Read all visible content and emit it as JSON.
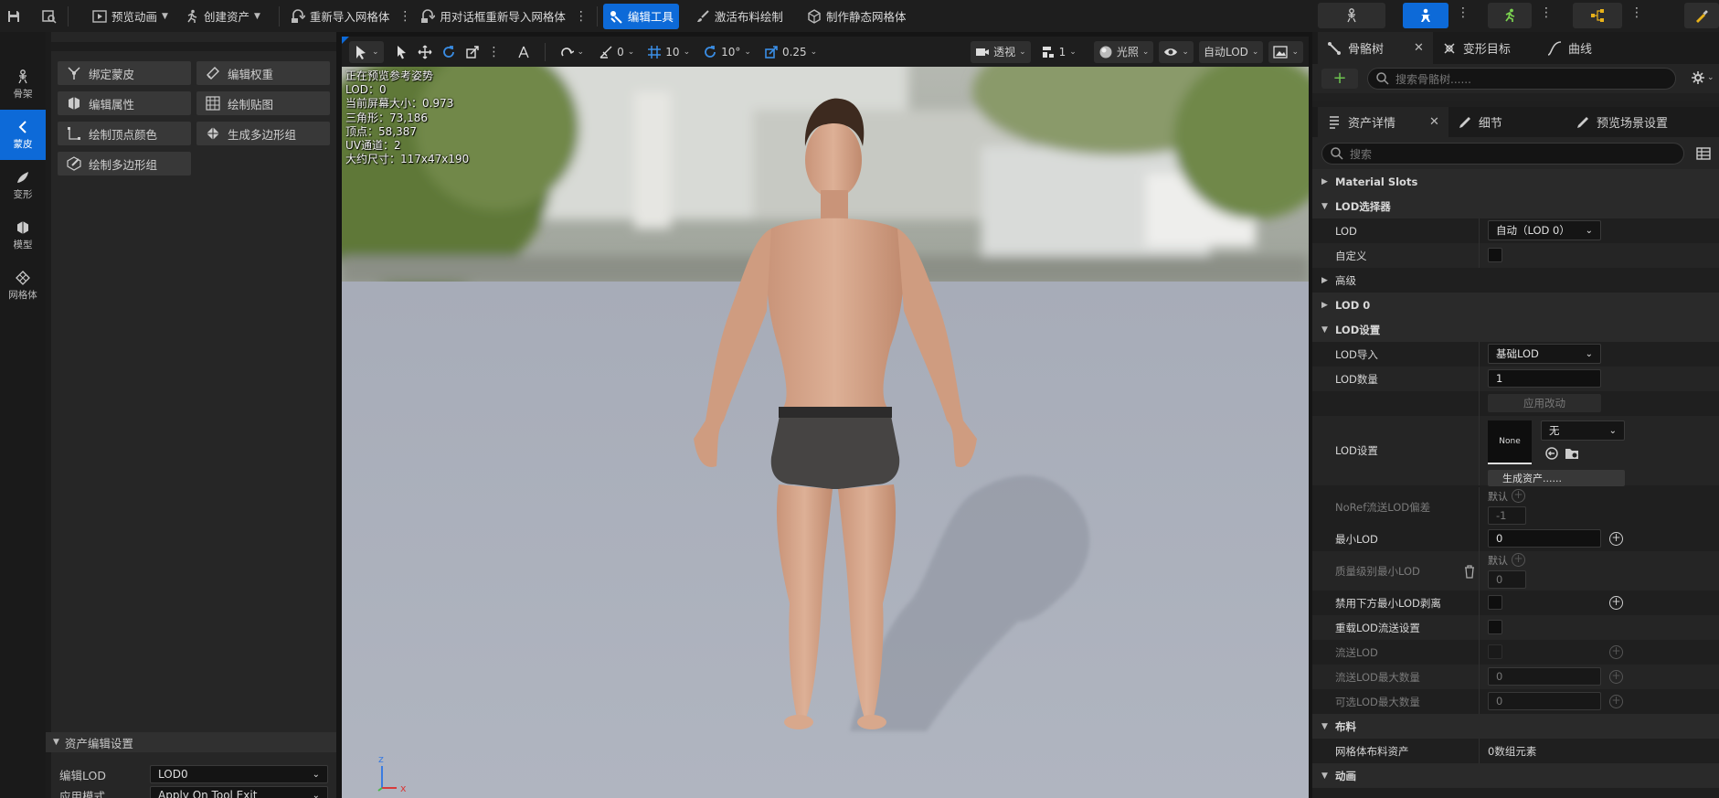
{
  "toolbar": {
    "preview_anim": "预览动画",
    "create_asset": "创建资产",
    "reimport_mesh": "重新导入网格体",
    "reimport_dialog": "用对话框重新导入网格体",
    "edit_tools": "编辑工具",
    "activate_cloth": "激活布料绘制",
    "make_static": "制作静态网格体"
  },
  "rail": {
    "items": [
      {
        "label": "骨架",
        "icon": "skeleton-icon"
      },
      {
        "label": "蒙皮",
        "icon": "skin-icon"
      },
      {
        "label": "变形",
        "icon": "deform-icon"
      },
      {
        "label": "模型",
        "icon": "model-icon"
      },
      {
        "label": "网格体",
        "icon": "mesh-icon"
      }
    ]
  },
  "tools": [
    {
      "label": "绑定蒙皮",
      "icon": "bind-skin-icon"
    },
    {
      "label": "编辑权重",
      "icon": "edit-weights-icon"
    },
    {
      "label": "编辑属性",
      "icon": "edit-attributes-icon"
    },
    {
      "label": "绘制贴图",
      "icon": "paint-maps-icon"
    },
    {
      "label": "绘制顶点颜色",
      "icon": "paint-vertex-color-icon"
    },
    {
      "label": "生成多边形组",
      "icon": "generate-polygroups-icon"
    },
    {
      "label": "绘制多边形组",
      "icon": "paint-polygroups-icon"
    }
  ],
  "asset_settings": {
    "header": "资产编辑设置",
    "edit_lod_label": "编辑LOD",
    "edit_lod_value": "LOD0",
    "apply_mode_label": "应用模式",
    "apply_mode_value": "Apply On Tool Exit"
  },
  "viewport": {
    "snap_rot": "0",
    "grid": "10",
    "angle": "10°",
    "scale": "0.25",
    "perspective": "透视",
    "layers": "1",
    "lighting": "光照",
    "auto_lod": "自动LOD",
    "stats": [
      "正在预览参考姿势",
      "LOD：0",
      "当前屏幕大小：0.973",
      "三角形：73,186",
      "顶点：58,387",
      "UV通道：2",
      "大约尺寸：117x47x190"
    ]
  },
  "right": {
    "top_tabs": [
      "骨骼树",
      "变形目标",
      "曲线"
    ],
    "search_bones_placeholder": "搜索骨骼树......",
    "second_tabs": [
      "资产详情",
      "细节",
      "预览场景设置"
    ],
    "search_placeholder": "搜索",
    "props": {
      "material_slots": "Material Slots",
      "lod_selector": "LOD选择器",
      "lod": "LOD",
      "lod_value": "自动（LOD 0）",
      "custom": "自定义",
      "advanced": "高级",
      "lod0": "LOD 0",
      "lod_settings_cat": "LOD设置",
      "lod_import": "LOD导入",
      "lod_import_value": "基础LOD",
      "lod_count": "LOD数量",
      "lod_count_value": "1",
      "apply_changes": "应用改动",
      "lod_settings": "LOD设置",
      "thumb_none": "None",
      "lod_settings_value": "无",
      "generate_asset": "生成资产......",
      "noref_bias": "NoRef流送LOD偏差",
      "default_label": "默认",
      "noref_value": "-1",
      "min_lod": "最小LOD",
      "min_lod_value": "0",
      "quality_min_lod": "质量级别最小LOD",
      "default_label2": "默认",
      "quality_value": "0",
      "disable_below_min": "禁用下方最小LOD剥离",
      "override_streaming": "重载LOD流送设置",
      "stream_lod": "流送LOD",
      "stream_max": "流送LOD最大数量",
      "stream_max_value": "0",
      "optional_max": "可选LOD最大数量",
      "optional_max_value": "0",
      "cloth": "布料",
      "cloth_asset": "网格体布料资产",
      "cloth_asset_value": "0数组元素",
      "animation": "动画"
    }
  },
  "colors": {
    "accent": "#0d6ad8",
    "panel": "#1f1f1f"
  }
}
